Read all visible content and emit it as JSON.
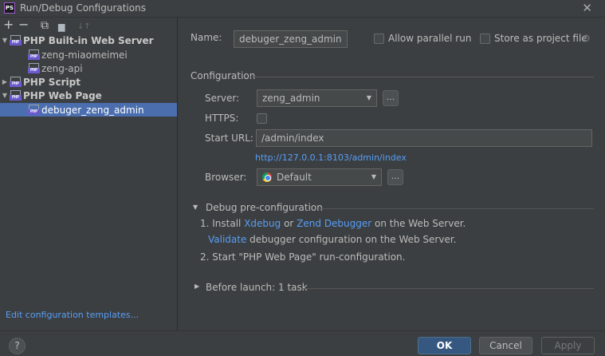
{
  "window": {
    "title": "Run/Debug Configurations",
    "app_icon_text": "PS"
  },
  "toolbar": {
    "add_icon": "+",
    "remove_icon": "−",
    "copy_icon": "⧉",
    "folder_icon": "▆",
    "sort_icon": "↓↑"
  },
  "tree": {
    "builtin_server": "PHP Built-in Web Server",
    "builtin_children": [
      "zeng-miaomeimei",
      "zeng-api"
    ],
    "php_script": "PHP Script",
    "php_web_page": "PHP Web Page",
    "web_page_children": [
      "debuger_zeng_admin"
    ]
  },
  "left_footer": {
    "edit_templates": "Edit configuration templates..."
  },
  "form": {
    "name_label": "Name:",
    "name_value": "debuger_zeng_admin",
    "allow_parallel": "Allow parallel run",
    "store_project": "Store as project file",
    "configuration_section": "Configuration",
    "server_label": "Server:",
    "server_value": "zeng_admin",
    "https_label": "HTTPS:",
    "start_url_label": "Start URL:",
    "start_url_value": "/admin/index",
    "resolved_url": "http://127.0.0.1:8103/admin/index",
    "browser_label": "Browser:",
    "browser_value": "Default",
    "dots": "..."
  },
  "debug": {
    "title": "Debug pre-configuration",
    "step1_prefix": "1. Install ",
    "xdebug": "Xdebug",
    "or": " or ",
    "zend": "Zend Debugger",
    "step1_suffix": " on the Web Server.",
    "validate": "Validate",
    "validate_suffix": " debugger configuration on the Web Server.",
    "step2": "2. Start \"PHP Web Page\" run-configuration."
  },
  "before_launch": {
    "title": "Before launch: 1 task"
  },
  "footer": {
    "help": "?",
    "ok": "OK",
    "cancel": "Cancel",
    "apply": "Apply"
  },
  "colors": {
    "background": "#3c3f41",
    "selection": "#4b6eaf",
    "link": "#589df6",
    "ok_button": "#365880"
  }
}
